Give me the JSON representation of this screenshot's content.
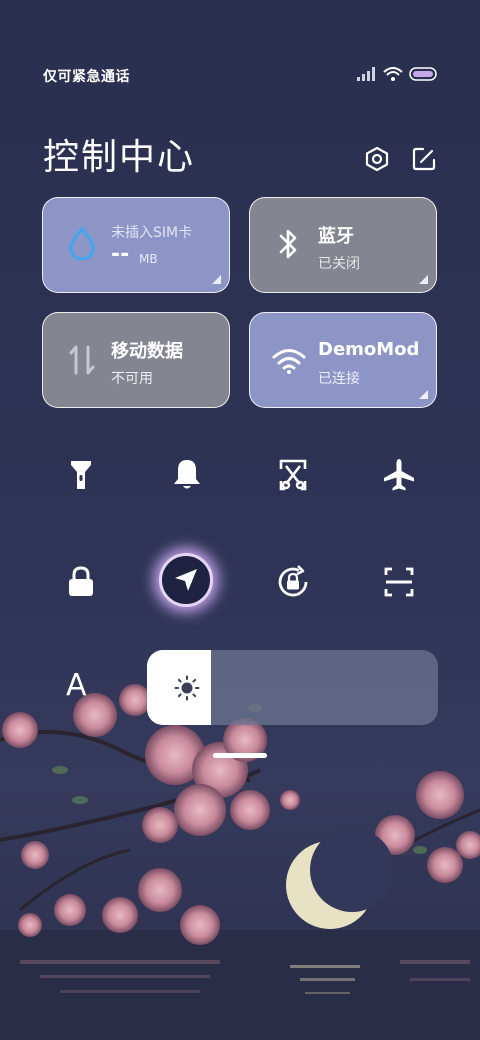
{
  "status_bar": {
    "carrier_text": "仅可紧急通话",
    "icons": [
      "signal-icon",
      "wifi-icon",
      "battery-icon"
    ]
  },
  "header": {
    "title": "控制中心",
    "settings_icon": "settings-icon",
    "edit_icon": "edit-icon"
  },
  "tiles": {
    "data_usage": {
      "label": "未插入SIM卡",
      "value": "--",
      "unit": "MB",
      "icon": "water-drop-icon",
      "color": "#8d95c7"
    },
    "bluetooth": {
      "label": "蓝牙",
      "status": "已关闭",
      "icon": "bluetooth-icon",
      "color": "#858591"
    },
    "mobile_data": {
      "label": "移动数据",
      "status": "不可用",
      "icon": "mobile-data-icon",
      "color": "#858591"
    },
    "wifi": {
      "label": "DemoMod",
      "status": "已连接",
      "icon": "wifi-icon",
      "color": "#8d95c7"
    }
  },
  "quick_toggles_row1": [
    "flashlight-icon",
    "bell-icon",
    "screenshot-icon",
    "airplane-icon"
  ],
  "quick_toggles_row2": [
    "lock-icon",
    "location-icon",
    "rotation-lock-icon",
    "scan-icon"
  ],
  "brightness": {
    "auto_label": "A",
    "level": 0.22,
    "icon": "sun-icon"
  },
  "colors": {
    "accent_blue": "#8d95c7",
    "tile_gray": "#858591",
    "background": "#2b3050",
    "location_glow": "#c9a8f0"
  }
}
